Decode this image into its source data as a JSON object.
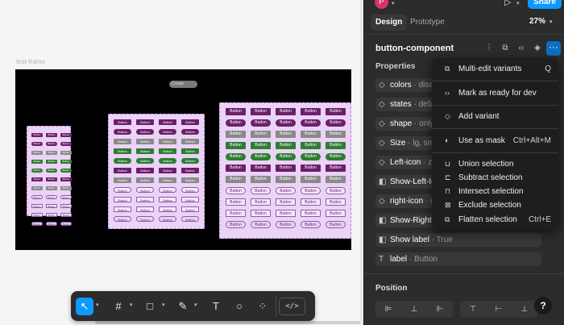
{
  "canvas": {
    "frame_label": "test-frame",
    "hint_chip": "Create"
  },
  "toolbar": {
    "move_icon": "↖",
    "frame_icon": "#",
    "rect_icon": "□",
    "pen_icon": "✎",
    "text_icon": "T",
    "comment_icon": "○",
    "actions_icon": "⁘",
    "dev_mode": "</>"
  },
  "header": {
    "avatar": "P",
    "share": "Share",
    "play_icon": "▷"
  },
  "tabs": {
    "design": "Design",
    "prototype": "Prototype",
    "zoom": "27%"
  },
  "component": {
    "title": "button-component",
    "more_icon": "···"
  },
  "properties": {
    "heading": "Properties",
    "rows": [
      {
        "name": "colors",
        "value": "· disab",
        "icon": "◇"
      },
      {
        "name": "states",
        "value": "· defau",
        "icon": "◇"
      },
      {
        "name": "shape",
        "value": "· only-",
        "icon": "◇"
      },
      {
        "name": "Size",
        "value": "· lg, sm,",
        "icon": "◇"
      },
      {
        "name": "Left-icon",
        "value": "· zo",
        "icon": "◇"
      },
      {
        "name": "Show-Left-Ico",
        "value": "",
        "icon": "◧"
      },
      {
        "name": "right-icon",
        "value": "· us",
        "icon": "◇"
      },
      {
        "name": "Show-Right-Ic",
        "value": "",
        "icon": "◧"
      },
      {
        "name": "Show label",
        "value": "· True",
        "icon": "◧"
      },
      {
        "name": "label",
        "value": "· Button",
        "icon": "T"
      }
    ]
  },
  "position": {
    "heading": "Position"
  },
  "help": "?",
  "menu": {
    "items": [
      {
        "label": "Multi-edit variants",
        "shortcut": "Q",
        "icon": "⧉"
      },
      {
        "label": "Mark as ready for dev",
        "shortcut": "",
        "icon": "‹›"
      },
      {
        "label": "Add variant",
        "shortcut": "",
        "icon": "◇"
      },
      {
        "label": "Use as mask",
        "shortcut": "Ctrl+Alt+M",
        "icon": "◐"
      },
      {
        "label": "Union selection",
        "shortcut": "",
        "icon": "⊔"
      },
      {
        "label": "Subtract selection",
        "shortcut": "",
        "icon": "⊏"
      },
      {
        "label": "Intersect selection",
        "shortcut": "",
        "icon": "⊓"
      },
      {
        "label": "Exclude selection",
        "shortcut": "",
        "icon": "⊠"
      },
      {
        "label": "Flatten selection",
        "shortcut": "Ctrl+E",
        "icon": "⧉"
      }
    ]
  },
  "buttons_preview": {
    "button_label": "Button"
  }
}
